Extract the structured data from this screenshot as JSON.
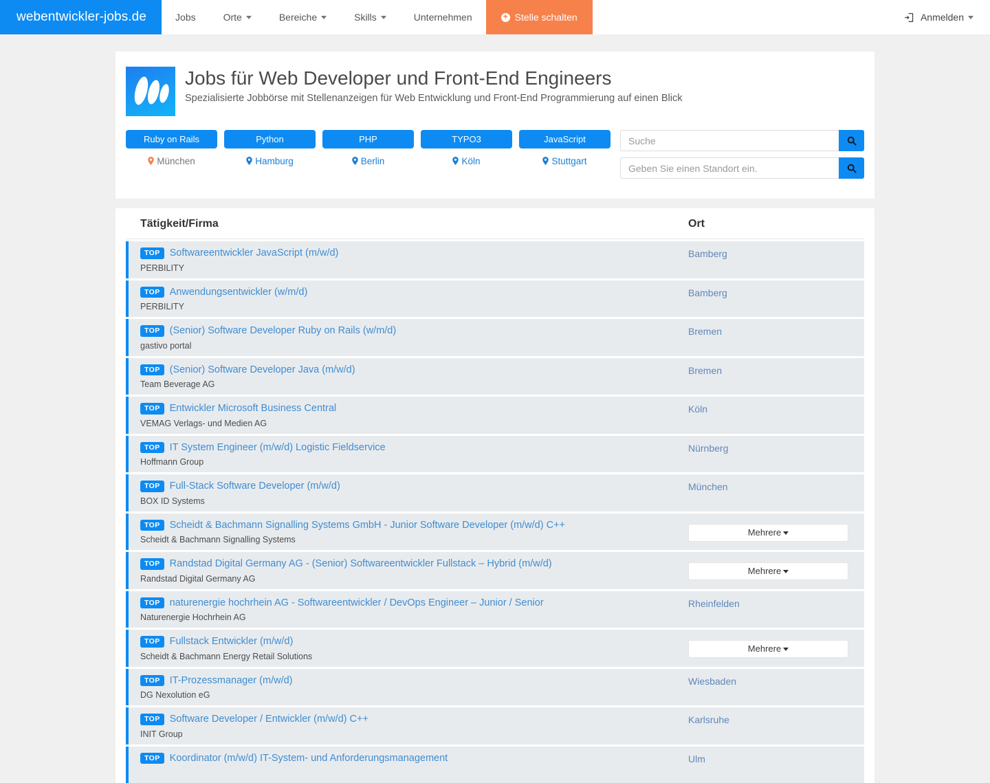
{
  "navbar": {
    "brand": "webentwickler-jobs.de",
    "items": [
      {
        "label": "Jobs",
        "caret": false
      },
      {
        "label": "Orte",
        "caret": true
      },
      {
        "label": "Bereiche",
        "caret": true
      },
      {
        "label": "Skills",
        "caret": true
      },
      {
        "label": "Unternehmen",
        "caret": false
      }
    ],
    "cta": {
      "label": "Stelle schalten",
      "icon": "plus-circle-icon",
      "color": "#f7814b"
    },
    "login": {
      "label": "Anmelden",
      "icon": "sign-in-icon",
      "caret": true
    },
    "brand_color": "#0d8bf2"
  },
  "header": {
    "logo_icon": "site-logo-icon",
    "title": "Jobs für Web Developer und Front-End Engineers",
    "subtitle": "Spezialisierte Jobbörse mit Stellenanzeigen für Web Entwicklung und Front-End Programmierung auf einen Blick"
  },
  "filters": {
    "tags": [
      "Ruby on Rails",
      "Python",
      "PHP",
      "TYPO3",
      "JavaScript"
    ],
    "cities": [
      {
        "label": "München",
        "active": true,
        "pin_color": "#f7814b"
      },
      {
        "label": "Hamburg",
        "active": false,
        "pin_color": "#1c7fd4"
      },
      {
        "label": "Berlin",
        "active": false,
        "pin_color": "#1c7fd4"
      },
      {
        "label": "Köln",
        "active": false,
        "pin_color": "#1c7fd4"
      },
      {
        "label": "Stuttgart",
        "active": false,
        "pin_color": "#1c7fd4"
      }
    ],
    "search": {
      "keyword_placeholder": "Suche",
      "keyword_value": "",
      "location_placeholder": "Geben Sie einen Standort ein.",
      "location_value": "",
      "button_icon": "search-icon"
    }
  },
  "table": {
    "columns": {
      "job": "Tätigkeit/Firma",
      "location": "Ort"
    },
    "badge_label": "TOP",
    "multi_label": "Mehrere",
    "rows": [
      {
        "badge": "TOP",
        "title": "Softwareentwickler JavaScript (m/w/d)",
        "company": "PERBILITY",
        "location": "Bamberg",
        "location_type": "link"
      },
      {
        "badge": "TOP",
        "title": "Anwendungsentwickler (w/m/d)",
        "company": "PERBILITY",
        "location": "Bamberg",
        "location_type": "link"
      },
      {
        "badge": "TOP",
        "title": "(Senior) Software Developer Ruby on Rails (w/m/d)",
        "company": "gastivo portal",
        "location": "Bremen",
        "location_type": "link"
      },
      {
        "badge": "TOP",
        "title": "(Senior) Software Developer Java (m/w/d)",
        "company": "Team Beverage AG",
        "location": "Bremen",
        "location_type": "link"
      },
      {
        "badge": "TOP",
        "title": "Entwickler Microsoft Business Central",
        "company": "VEMAG Verlags- und Medien AG",
        "location": "Köln",
        "location_type": "link"
      },
      {
        "badge": "TOP",
        "title": "IT System Engineer (m/w/d) Logistic Fieldservice",
        "company": "Hoffmann Group",
        "location": "Nürnberg",
        "location_type": "link"
      },
      {
        "badge": "TOP",
        "title": "Full-Stack Software Developer (m/w/d)",
        "company": "BOX ID Systems",
        "location": "München",
        "location_type": "link"
      },
      {
        "badge": "TOP",
        "title": "Scheidt & Bachmann Signalling Systems GmbH - Junior Software Developer (m/w/d) C++",
        "company": "Scheidt & Bachmann Signalling Systems",
        "location": "Mehrere",
        "location_type": "dropdown"
      },
      {
        "badge": "TOP",
        "title": "Randstad Digital Germany AG - (Senior) Softwareentwickler Fullstack – Hybrid (m/w/d)",
        "company": "Randstad Digital Germany AG",
        "location": "Mehrere",
        "location_type": "dropdown"
      },
      {
        "badge": "TOP",
        "title": "naturenergie hochrhein AG - Softwareentwickler / DevOps Engineer – Junior / Senior",
        "company": "Naturenergie Hochrhein AG",
        "location": "Rheinfelden",
        "location_type": "link"
      },
      {
        "badge": "TOP",
        "title": "Fullstack Entwickler (m/w/d)",
        "company": "Scheidt & Bachmann Energy Retail Solutions",
        "location": "Mehrere",
        "location_type": "dropdown"
      },
      {
        "badge": "TOP",
        "title": "IT-Prozessmanager (m/w/d)",
        "company": "DG Nexolution eG",
        "location": "Wiesbaden",
        "location_type": "link"
      },
      {
        "badge": "TOP",
        "title": "Software Developer / Entwickler (m/w/d) C++",
        "company": "INIT Group",
        "location": "Karlsruhe",
        "location_type": "link"
      },
      {
        "badge": "TOP",
        "title": "Koordinator (m/w/d) IT-System- und Anforderungsmanagement",
        "company": "",
        "location": "Ulm",
        "location_type": "link"
      }
    ]
  }
}
